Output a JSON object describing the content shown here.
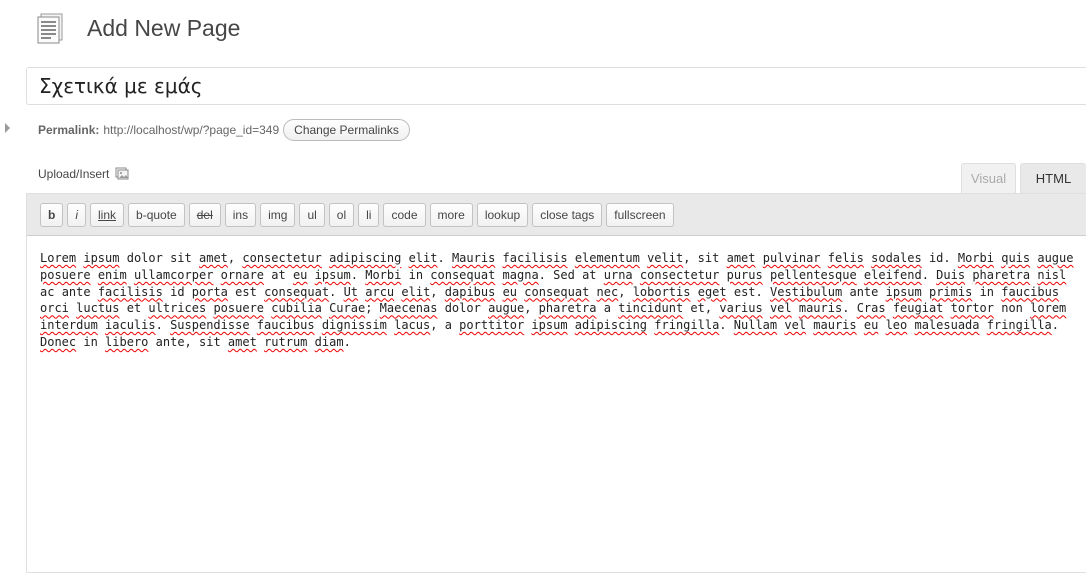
{
  "header": {
    "title": "Add New Page",
    "icon": "page-icon"
  },
  "post_title": {
    "value": "Σχετικά με εμάς"
  },
  "permalink": {
    "label": "Permalink:",
    "url": "http://localhost/wp/?page_id=349",
    "change_label": "Change Permalinks"
  },
  "upload": {
    "label": "Upload/Insert",
    "icon": "media-icon"
  },
  "tabs": {
    "visual": "Visual",
    "html": "HTML",
    "active": "html"
  },
  "toolbar": {
    "buttons": [
      "b",
      "i",
      "link",
      "b-quote",
      "del",
      "ins",
      "img",
      "ul",
      "ol",
      "li",
      "code",
      "more",
      "lookup",
      "close tags",
      "fullscreen"
    ]
  },
  "content": {
    "text": "Lorem ipsum dolor sit amet, consectetur adipiscing elit. Mauris facilisis elementum velit, sit amet pulvinar felis sodales id. Morbi quis augue posuere enim ullamcorper ornare at eu ipsum. Morbi in consequat magna. Sed at urna consectetur purus pellentesque eleifend. Duis pharetra nisl ac ante facilisis id porta est consequat. Ut arcu elit, dapibus eu consequat nec, lobortis eget est. Vestibulum ante ipsum primis in faucibus orci luctus et ultrices posuere cubilia Curae; Maecenas dolor augue, pharetra a tincidunt et, varius vel mauris. Cras feugiat tortor non lorem interdum iaculis. Suspendisse faucibus dignissim lacus, a porttitor ipsum adipiscing fringilla. Nullam vel mauris eu leo malesuada fringilla. Donec in libero ante, sit amet rutrum diam.",
    "misspelled": [
      "Lorem",
      "ipsum",
      "amet",
      "consectetur",
      "adipiscing",
      "elit",
      "Mauris",
      "facilisis",
      "elementum",
      "velit",
      "pulvinar",
      "felis",
      "sodales",
      "Morbi",
      "quis",
      "augue",
      "posuere",
      "enim",
      "ullamcorper",
      "ornare",
      "eu",
      "consequat",
      "magna",
      "urna",
      "purus",
      "pellentesque",
      "eleifend",
      "Duis",
      "pharetra",
      "nisl",
      "porta",
      "Ut",
      "arcu",
      "dapibus",
      "nec",
      "lobortis",
      "eget",
      "Vestibulum",
      "primis",
      "faucibus",
      "orci",
      "luctus",
      "ultrices",
      "cubilia",
      "Curae",
      "Maecenas",
      "tincidunt",
      "varius",
      "vel",
      "mauris",
      "Cras",
      "feugiat",
      "tortor",
      "lorem",
      "interdum",
      "iaculis",
      "Suspendisse",
      "dignissim",
      "lacus",
      "porttitor",
      "fringilla",
      "Nullam",
      "leo",
      "malesuada",
      "Donec",
      "libero",
      "rutrum",
      "diam"
    ]
  },
  "colors": {
    "spellcheck": "#e00000",
    "toolbar_bg": "#e9e9e9"
  }
}
